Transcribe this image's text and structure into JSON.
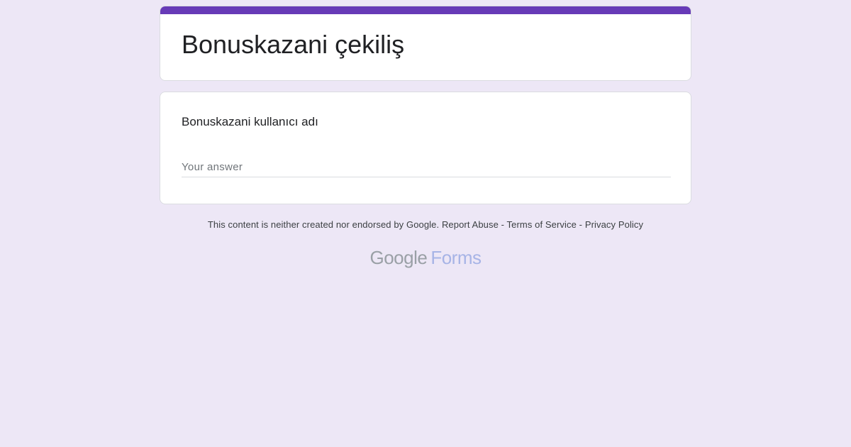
{
  "form": {
    "title": "Bonuskazani çekiliş",
    "accent_color": "#673ab7",
    "background_color": "#ede7f6"
  },
  "question": {
    "label": "Bonuskazani kullanıcı adı",
    "placeholder": "Your answer",
    "value": ""
  },
  "footer": {
    "disclaimer": "This content is neither created nor endorsed by Google.",
    "report_abuse": "Report Abuse",
    "sep1": " - ",
    "terms": "Terms of Service",
    "sep2": " - ",
    "privacy": "Privacy Policy"
  },
  "brand": {
    "google": "Google",
    "forms": "Forms"
  }
}
